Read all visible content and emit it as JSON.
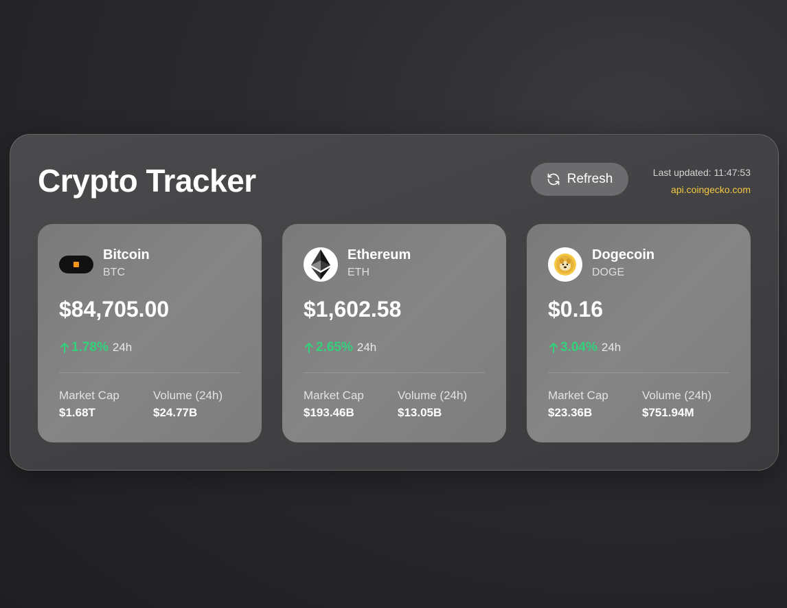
{
  "header": {
    "title": "Crypto Tracker",
    "refresh_label": "Refresh",
    "last_updated": "Last updated: 11:47:53",
    "api_source": "api.coingecko.com"
  },
  "coins": [
    {
      "name": "Bitcoin",
      "symbol": "BTC",
      "price": "$84,705.00",
      "change": "1.78%",
      "period": "24h",
      "market_cap_label": "Market Cap",
      "market_cap": "$1.68T",
      "volume_label": "Volume (24h)",
      "volume": "$24.77B"
    },
    {
      "name": "Ethereum",
      "symbol": "ETH",
      "price": "$1,602.58",
      "change": "2.65%",
      "period": "24h",
      "market_cap_label": "Market Cap",
      "market_cap": "$193.46B",
      "volume_label": "Volume (24h)",
      "volume": "$13.05B"
    },
    {
      "name": "Dogecoin",
      "symbol": "DOGE",
      "price": "$0.16",
      "change": "3.04%",
      "period": "24h",
      "market_cap_label": "Market Cap",
      "market_cap": "$23.36B",
      "volume_label": "Volume (24h)",
      "volume": "$751.94M"
    }
  ],
  "colors": {
    "positive": "#33d17a",
    "accent_link": "#f5c842",
    "button_bg": "#6c6c6e"
  },
  "icons": {
    "refresh": "refresh-icon",
    "up_arrow": "arrow-up-icon",
    "bitcoin_logo": "bitcoin-logo",
    "ethereum_logo": "ethereum-logo",
    "dogecoin_logo": "dogecoin-logo"
  }
}
